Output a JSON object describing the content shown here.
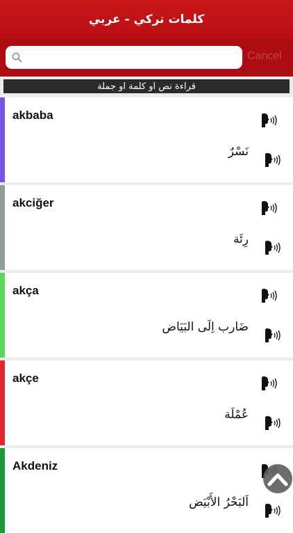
{
  "header": {
    "title": "كلمات تركي - عربي"
  },
  "search": {
    "placeholder": "",
    "value": "",
    "cancel_label": "Cancel"
  },
  "read_bar": {
    "label": "قراءة  نص او كلمة او جملة"
  },
  "entries": [
    {
      "word": "akbaba",
      "translation": "نَسْرٌ",
      "color": "#7b52e8"
    },
    {
      "word": "akciğer",
      "translation": "رِئَة",
      "color": "#8f9e9a"
    },
    {
      "word": "akça",
      "translation": "ضَارب اِلَى البَيَاض",
      "color": "#5ed65b"
    },
    {
      "word": "akçe",
      "translation": "عُمْلَة",
      "color": "#e0262f"
    },
    {
      "word": "Akdeniz",
      "translation": "اَلبَحْرُ الأَبْيَض",
      "color": "#1a9a3a"
    }
  ],
  "icons": {
    "search": "search-icon",
    "speaker": "speaker-icon",
    "scroll_top": "chevron-up-icon"
  }
}
